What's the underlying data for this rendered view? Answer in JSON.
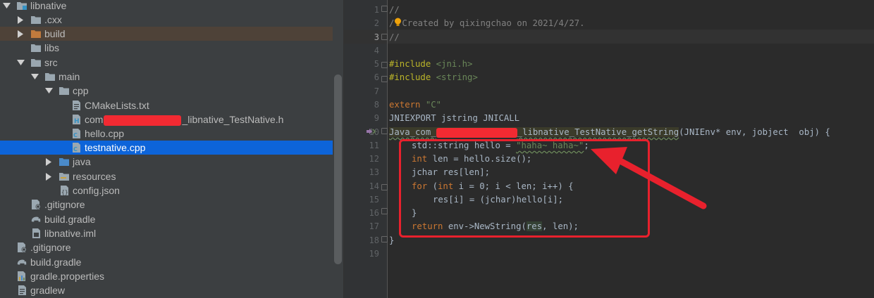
{
  "tree": {
    "items": [
      {
        "label": "libnative",
        "depth": 0,
        "arrow": "down",
        "icon": "module-folder",
        "highlight": ""
      },
      {
        "label": ".cxx",
        "depth": 1,
        "arrow": "right",
        "icon": "folder",
        "highlight": ""
      },
      {
        "label": "build",
        "depth": 1,
        "arrow": "right",
        "icon": "folder-orange",
        "highlight": "build"
      },
      {
        "label": "libs",
        "depth": 1,
        "arrow": "none",
        "icon": "folder",
        "highlight": ""
      },
      {
        "label": "src",
        "depth": 1,
        "arrow": "down",
        "icon": "folder",
        "highlight": ""
      },
      {
        "label": "main",
        "depth": 2,
        "arrow": "down",
        "icon": "folder",
        "highlight": ""
      },
      {
        "label": "cpp",
        "depth": 3,
        "arrow": "down",
        "icon": "folder",
        "highlight": ""
      },
      {
        "label": "CMakeLists.txt",
        "depth": 4,
        "arrow": "none",
        "icon": "text-file",
        "highlight": ""
      },
      {
        "label_prefix": "com",
        "label_suffix": "_libnative_TestNative.h",
        "redacted": true,
        "depth": 4,
        "arrow": "none",
        "icon": "header-file",
        "highlight": ""
      },
      {
        "label": "hello.cpp",
        "depth": 4,
        "arrow": "none",
        "icon": "cpp-file",
        "highlight": ""
      },
      {
        "label": "testnative.cpp",
        "depth": 4,
        "arrow": "none",
        "icon": "cpp-file",
        "highlight": "selected"
      },
      {
        "label": "java",
        "depth": 3,
        "arrow": "right",
        "icon": "folder-blue",
        "highlight": ""
      },
      {
        "label": "resources",
        "depth": 3,
        "arrow": "right",
        "icon": "folder-res",
        "highlight": ""
      },
      {
        "label": "config.json",
        "depth": 3,
        "arrow": "none",
        "icon": "json-file",
        "highlight": ""
      },
      {
        "label": ".gitignore",
        "depth": 1,
        "arrow": "none",
        "icon": "gitignore-file",
        "highlight": ""
      },
      {
        "label": "build.gradle",
        "depth": 1,
        "arrow": "none",
        "icon": "gradle-file",
        "highlight": ""
      },
      {
        "label": "libnative.iml",
        "depth": 1,
        "arrow": "none",
        "icon": "iml-file",
        "highlight": ""
      },
      {
        "label": ".gitignore",
        "depth": 0,
        "arrow": "none",
        "icon": "gitignore-file",
        "highlight": ""
      },
      {
        "label": "build.gradle",
        "depth": 0,
        "arrow": "none",
        "icon": "gradle-file",
        "highlight": ""
      },
      {
        "label": "gradle.properties",
        "depth": 0,
        "arrow": "none",
        "icon": "properties-file",
        "highlight": ""
      },
      {
        "label": "gradlew",
        "depth": 0,
        "arrow": "none",
        "icon": "text-file",
        "highlight": ""
      }
    ]
  },
  "editor": {
    "current_line": 3,
    "line_numbers": [
      "1",
      "2",
      "3",
      "4",
      "5",
      "6",
      "7",
      "8",
      "9",
      "10",
      "11",
      "12",
      "13",
      "14",
      "15",
      "16",
      "17",
      "18",
      "19"
    ],
    "lines": {
      "l1": "//",
      "l2_prefix": "/",
      "l2_text": "Created by qixingchao on 2021/4/27.",
      "l3": "//",
      "l5_kw": "#include",
      "l5_arg": " <jni.h>",
      "l6_kw": "#include",
      "l6_arg": " <string>",
      "l8_kw": "extern",
      "l8_str": " \"C\"",
      "l9": "JNIEXPORT jstring JNICALL",
      "l10_prefix": "Java_com_",
      "l10_suffix": "_libnative_TestNative_getString",
      "l10_params": "(JNIEnv* env, jobject  obj) {",
      "l11_a": "std::string hello = ",
      "l11_str": "\"haha~ haha~\"",
      "l11_b": ";",
      "l12_kw": "int",
      "l12_rest": " len = hello.size();",
      "l13": "jchar res[len];",
      "l14_kw": "for",
      "l14_a": " (",
      "l14_kw2": "int",
      "l14_b": " i = 0; i < len; i++) {",
      "l15": "res[i] = (jchar)hello[i];",
      "l16": "}",
      "l17_kw": "return",
      "l17_a": " env->NewString(",
      "l17_res": "res",
      "l17_b": ", len);",
      "l18": "}"
    }
  },
  "colors": {
    "keyword": "#cc7832",
    "string": "#6a8759",
    "comment": "#808080",
    "annotation_box": "#e8212d",
    "selection": "#0d64d9"
  }
}
